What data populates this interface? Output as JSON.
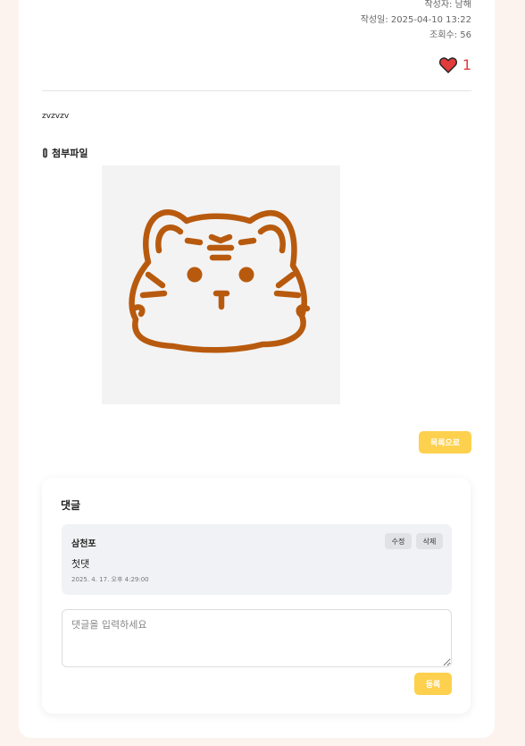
{
  "post": {
    "author": "작성자: 남해",
    "date": "작성일: 2025-04-10 13:22",
    "views": "조회수: 56",
    "likes": "1",
    "content": "zvzvzv",
    "attachment_title": "첨부파일",
    "list_button": "목록으로"
  },
  "colors": {
    "accent": "#fdd04e",
    "heart": "#e23b3b",
    "tiger": "#b85a0e"
  },
  "comments": {
    "title": "댓글",
    "items": [
      {
        "author": "삼천포",
        "text": "첫댓",
        "date": "2025. 4. 17. 오후 4:29:00",
        "edit_label": "수정",
        "delete_label": "삭제"
      }
    ],
    "input_placeholder": "댓글을 입력하세요",
    "submit_label": "등록"
  }
}
